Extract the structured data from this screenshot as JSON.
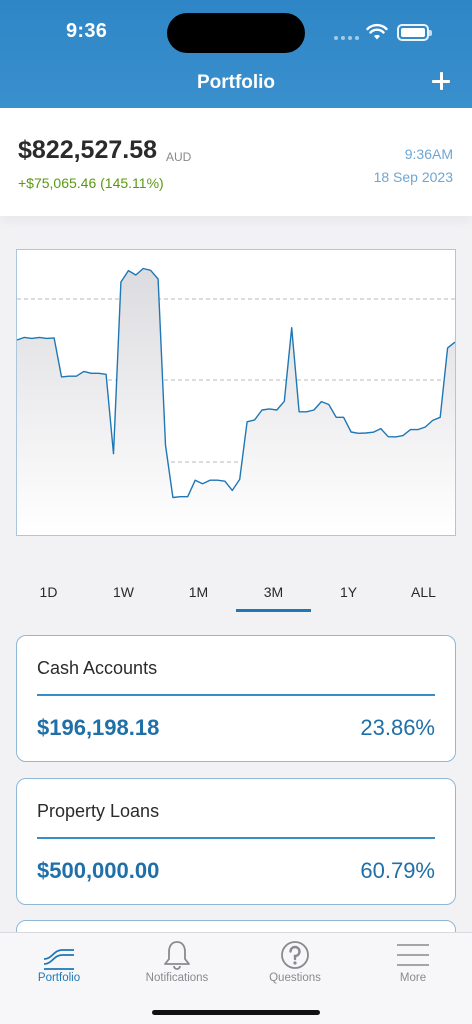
{
  "status_bar": {
    "time": "9:36"
  },
  "nav": {
    "title": "Portfolio",
    "add_icon": "plus-icon"
  },
  "summary": {
    "total_value": "$822,527.58",
    "currency": "AUD",
    "change": "+$75,065.46 (145.11%)",
    "time": "9:36AM",
    "date": "18 Sep 2023"
  },
  "chart_data": {
    "type": "area",
    "title": "",
    "xlabel": "",
    "ylabel": "",
    "grid": "horizontal dashed",
    "x_axis_labels_shown": false,
    "y_axis_labels_shown": false,
    "color": "#1f77b4",
    "values": [
      0.687,
      0.697,
      0.693,
      0.697,
      0.693,
      0.695,
      0.546,
      0.549,
      0.549,
      0.567,
      0.56,
      0.56,
      0.556,
      0.253,
      0.908,
      0.952,
      0.935,
      0.96,
      0.953,
      0.92,
      0.286,
      0.086,
      0.089,
      0.089,
      0.152,
      0.138,
      0.152,
      0.152,
      0.148,
      0.113,
      0.155,
      0.375,
      0.382,
      0.42,
      0.424,
      0.42,
      0.453,
      0.734,
      0.413,
      0.413,
      0.42,
      0.452,
      0.441,
      0.392,
      0.392,
      0.336,
      0.331,
      0.332,
      0.335,
      0.349,
      0.318,
      0.317,
      0.322,
      0.345,
      0.345,
      0.355,
      0.38,
      0.392,
      0.657,
      0.679
    ]
  },
  "ranges": {
    "options": [
      "1D",
      "1W",
      "1M",
      "3M",
      "1Y",
      "ALL"
    ],
    "selected": "3M"
  },
  "cards": [
    {
      "title": "Cash Accounts",
      "amount": "$196,198.18",
      "percent": "23.86%"
    },
    {
      "title": "Property Loans",
      "amount": "$500,000.00",
      "percent": "60.79%"
    }
  ],
  "tabbar": {
    "items": [
      {
        "label": "Portfolio",
        "icon": "portfolio-chart-icon",
        "active": true
      },
      {
        "label": "Notifications",
        "icon": "bell-icon",
        "active": false
      },
      {
        "label": "Questions",
        "icon": "question-icon",
        "active": false
      },
      {
        "label": "More",
        "icon": "menu-icon",
        "active": false
      }
    ]
  },
  "colors": {
    "header_blue": "#2f86c6",
    "accent_blue": "#1f6fa8",
    "gain_green": "#5a9a12"
  }
}
